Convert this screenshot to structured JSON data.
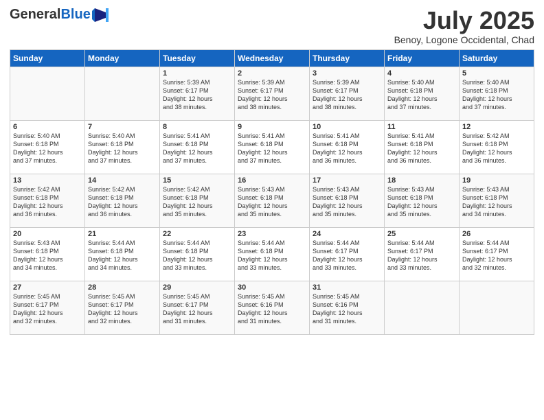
{
  "header": {
    "logo_general": "General",
    "logo_blue": "Blue",
    "month": "July 2025",
    "location": "Benoy, Logone Occidental, Chad"
  },
  "days_of_week": [
    "Sunday",
    "Monday",
    "Tuesday",
    "Wednesday",
    "Thursday",
    "Friday",
    "Saturday"
  ],
  "weeks": [
    [
      {
        "day": "",
        "info": ""
      },
      {
        "day": "",
        "info": ""
      },
      {
        "day": "1",
        "info": "Sunrise: 5:39 AM\nSunset: 6:17 PM\nDaylight: 12 hours\nand 38 minutes."
      },
      {
        "day": "2",
        "info": "Sunrise: 5:39 AM\nSunset: 6:17 PM\nDaylight: 12 hours\nand 38 minutes."
      },
      {
        "day": "3",
        "info": "Sunrise: 5:39 AM\nSunset: 6:17 PM\nDaylight: 12 hours\nand 38 minutes."
      },
      {
        "day": "4",
        "info": "Sunrise: 5:40 AM\nSunset: 6:18 PM\nDaylight: 12 hours\nand 37 minutes."
      },
      {
        "day": "5",
        "info": "Sunrise: 5:40 AM\nSunset: 6:18 PM\nDaylight: 12 hours\nand 37 minutes."
      }
    ],
    [
      {
        "day": "6",
        "info": "Sunrise: 5:40 AM\nSunset: 6:18 PM\nDaylight: 12 hours\nand 37 minutes."
      },
      {
        "day": "7",
        "info": "Sunrise: 5:40 AM\nSunset: 6:18 PM\nDaylight: 12 hours\nand 37 minutes."
      },
      {
        "day": "8",
        "info": "Sunrise: 5:41 AM\nSunset: 6:18 PM\nDaylight: 12 hours\nand 37 minutes."
      },
      {
        "day": "9",
        "info": "Sunrise: 5:41 AM\nSunset: 6:18 PM\nDaylight: 12 hours\nand 37 minutes."
      },
      {
        "day": "10",
        "info": "Sunrise: 5:41 AM\nSunset: 6:18 PM\nDaylight: 12 hours\nand 36 minutes."
      },
      {
        "day": "11",
        "info": "Sunrise: 5:41 AM\nSunset: 6:18 PM\nDaylight: 12 hours\nand 36 minutes."
      },
      {
        "day": "12",
        "info": "Sunrise: 5:42 AM\nSunset: 6:18 PM\nDaylight: 12 hours\nand 36 minutes."
      }
    ],
    [
      {
        "day": "13",
        "info": "Sunrise: 5:42 AM\nSunset: 6:18 PM\nDaylight: 12 hours\nand 36 minutes."
      },
      {
        "day": "14",
        "info": "Sunrise: 5:42 AM\nSunset: 6:18 PM\nDaylight: 12 hours\nand 36 minutes."
      },
      {
        "day": "15",
        "info": "Sunrise: 5:42 AM\nSunset: 6:18 PM\nDaylight: 12 hours\nand 35 minutes."
      },
      {
        "day": "16",
        "info": "Sunrise: 5:43 AM\nSunset: 6:18 PM\nDaylight: 12 hours\nand 35 minutes."
      },
      {
        "day": "17",
        "info": "Sunrise: 5:43 AM\nSunset: 6:18 PM\nDaylight: 12 hours\nand 35 minutes."
      },
      {
        "day": "18",
        "info": "Sunrise: 5:43 AM\nSunset: 6:18 PM\nDaylight: 12 hours\nand 35 minutes."
      },
      {
        "day": "19",
        "info": "Sunrise: 5:43 AM\nSunset: 6:18 PM\nDaylight: 12 hours\nand 34 minutes."
      }
    ],
    [
      {
        "day": "20",
        "info": "Sunrise: 5:43 AM\nSunset: 6:18 PM\nDaylight: 12 hours\nand 34 minutes."
      },
      {
        "day": "21",
        "info": "Sunrise: 5:44 AM\nSunset: 6:18 PM\nDaylight: 12 hours\nand 34 minutes."
      },
      {
        "day": "22",
        "info": "Sunrise: 5:44 AM\nSunset: 6:18 PM\nDaylight: 12 hours\nand 33 minutes."
      },
      {
        "day": "23",
        "info": "Sunrise: 5:44 AM\nSunset: 6:18 PM\nDaylight: 12 hours\nand 33 minutes."
      },
      {
        "day": "24",
        "info": "Sunrise: 5:44 AM\nSunset: 6:17 PM\nDaylight: 12 hours\nand 33 minutes."
      },
      {
        "day": "25",
        "info": "Sunrise: 5:44 AM\nSunset: 6:17 PM\nDaylight: 12 hours\nand 33 minutes."
      },
      {
        "day": "26",
        "info": "Sunrise: 5:44 AM\nSunset: 6:17 PM\nDaylight: 12 hours\nand 32 minutes."
      }
    ],
    [
      {
        "day": "27",
        "info": "Sunrise: 5:45 AM\nSunset: 6:17 PM\nDaylight: 12 hours\nand 32 minutes."
      },
      {
        "day": "28",
        "info": "Sunrise: 5:45 AM\nSunset: 6:17 PM\nDaylight: 12 hours\nand 32 minutes."
      },
      {
        "day": "29",
        "info": "Sunrise: 5:45 AM\nSunset: 6:17 PM\nDaylight: 12 hours\nand 31 minutes."
      },
      {
        "day": "30",
        "info": "Sunrise: 5:45 AM\nSunset: 6:16 PM\nDaylight: 12 hours\nand 31 minutes."
      },
      {
        "day": "31",
        "info": "Sunrise: 5:45 AM\nSunset: 6:16 PM\nDaylight: 12 hours\nand 31 minutes."
      },
      {
        "day": "",
        "info": ""
      },
      {
        "day": "",
        "info": ""
      }
    ]
  ]
}
